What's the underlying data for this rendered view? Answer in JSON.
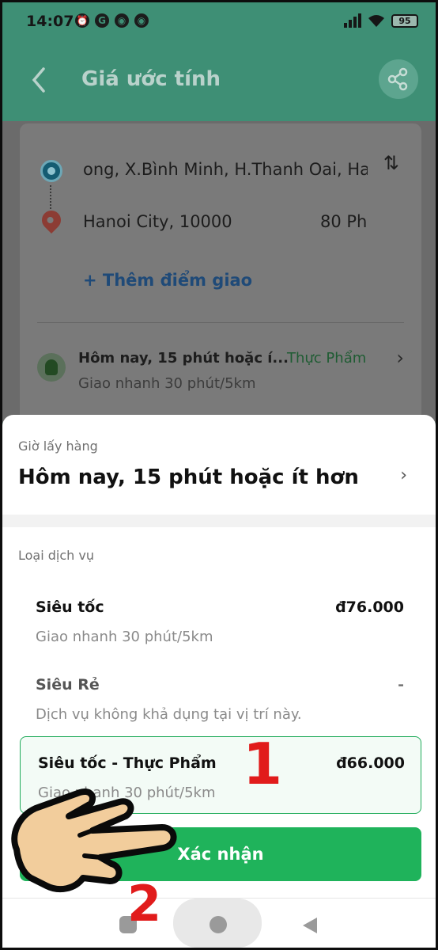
{
  "status_bar": {
    "time": "14:07",
    "icons": [
      "alarm-icon",
      "g-icon",
      "chrome-icon",
      "chrome-icon"
    ],
    "battery": "95"
  },
  "header": {
    "title": "Giá ước tính",
    "back_icon": "chevron-left-icon",
    "share_icon": "share-icon"
  },
  "route": {
    "pickup_address": "ong, X.Bình Minh, H.Thanh Oai, Ha",
    "dropoff_address": "Hanoi City, 10000",
    "dropoff_extra": "80 Ph",
    "add_stop": "+ Thêm điểm giao",
    "schedule": "Hôm nay, 15 phút hoặc í...",
    "schedule_sub": "Giao nhanh 30 phút/5km",
    "category": "Thực Phẩm"
  },
  "sheet": {
    "pickup_label": "Giờ lấy hàng",
    "pickup_value": "Hôm nay, 15 phút hoặc ít hơn",
    "service_label": "Loại dịch vụ",
    "services": [
      {
        "name": "Siêu tốc",
        "price": "đ76.000",
        "desc": "Giao nhanh 30 phút/5km"
      },
      {
        "name": "Siêu Rẻ",
        "price": "-",
        "desc": "Dịch vụ không khả dụng tại vị trí này."
      },
      {
        "name": "Siêu tốc - Thực Phẩm",
        "price": "đ66.000",
        "desc": "Giao nhanh 30 phút/5km"
      }
    ],
    "confirm_label": "Xác nhận"
  },
  "annotations": {
    "step1": "1",
    "step2": "2"
  },
  "colors": {
    "brand_green": "#1fb35b",
    "header_teal": "#3e8f75",
    "annotation_red": "#e11b1b"
  }
}
